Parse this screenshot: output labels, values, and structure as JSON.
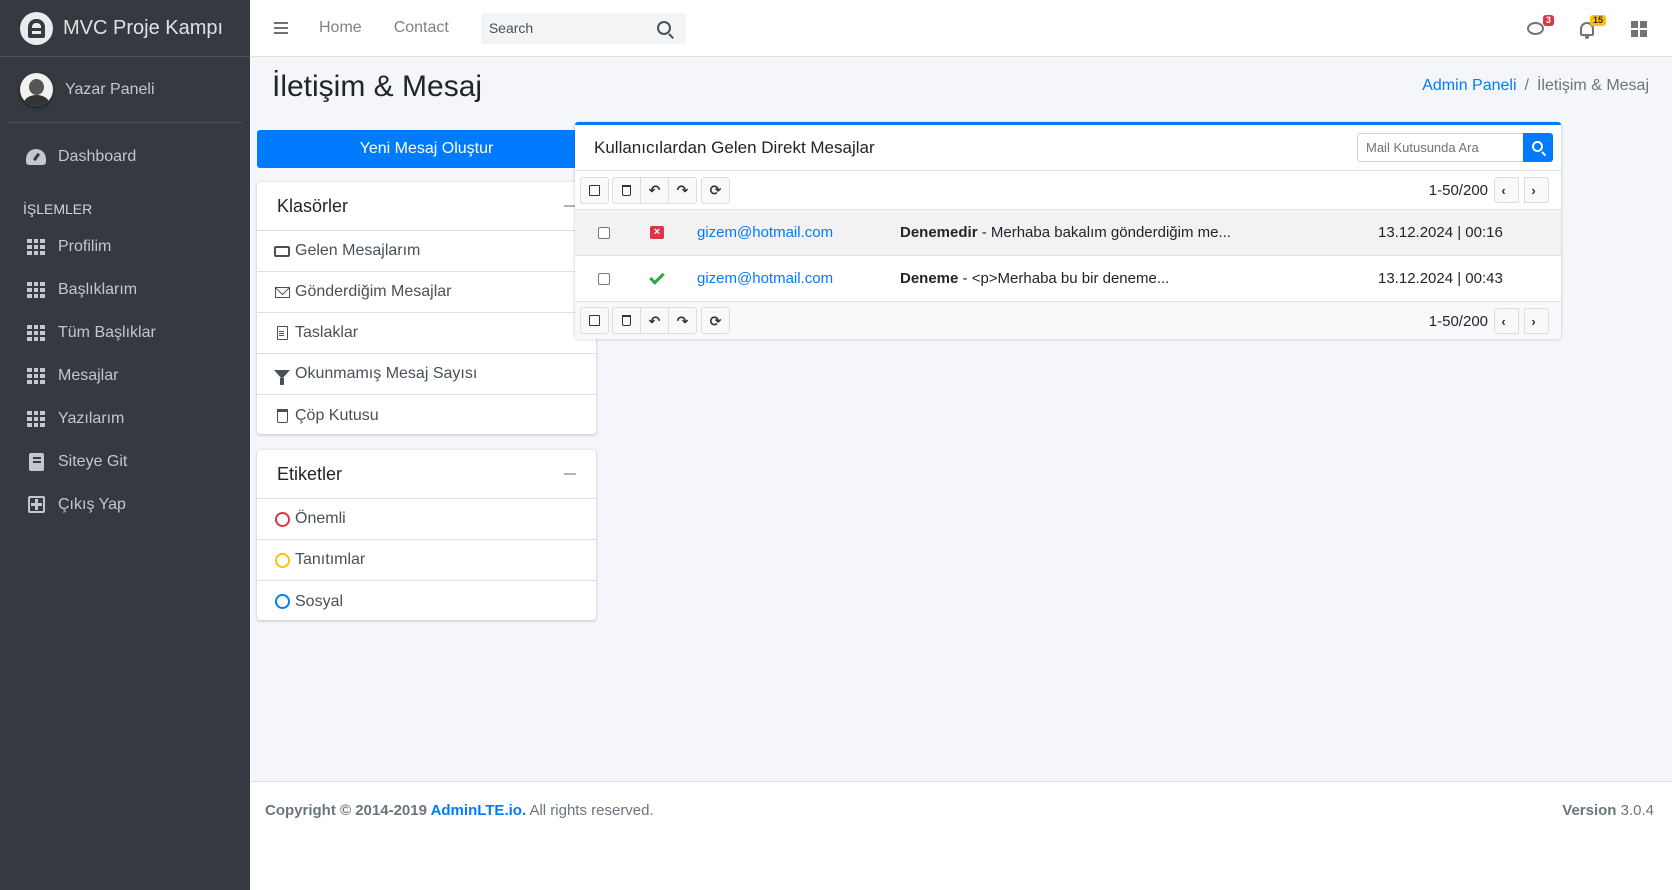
{
  "brand": {
    "name": "MVC Proje Kampı"
  },
  "user": {
    "name": "Yazar Paneli"
  },
  "sidebar": {
    "dashboard": "Dashboard",
    "section_header": "İŞLEMLER",
    "items": [
      {
        "label": "Profilim",
        "icon": "grid-icon"
      },
      {
        "label": "Başlıklarım",
        "icon": "grid-icon"
      },
      {
        "label": "Tüm Başlıklar",
        "icon": "grid-icon"
      },
      {
        "label": "Mesajlar",
        "icon": "grid-icon"
      },
      {
        "label": "Yazılarım",
        "icon": "grid-icon"
      },
      {
        "label": "Siteye Git",
        "icon": "book-icon"
      },
      {
        "label": "Çıkış Yap",
        "icon": "plus-square-icon"
      }
    ]
  },
  "topbar": {
    "links": [
      "Home",
      "Contact"
    ],
    "search_placeholder": "Search",
    "messages_badge": "3",
    "notifications_badge": "15"
  },
  "page": {
    "title": "İletişim & Mesaj",
    "breadcrumb": [
      "Admin Paneli",
      "İletişim & Mesaj"
    ]
  },
  "compose_button": "Yeni Mesaj Oluştur",
  "folders": {
    "title": "Klasörler",
    "items": [
      {
        "label": "Gelen Mesajlarım",
        "icon": "inbox-icon"
      },
      {
        "label": "Gönderdiğim Mesajlar",
        "icon": "envelope-icon"
      },
      {
        "label": "Taslaklar",
        "icon": "file-icon"
      },
      {
        "label": "Okunmamış Mesaj Sayısı",
        "icon": "filter-icon"
      },
      {
        "label": "Çöp Kutusu",
        "icon": "trash-icon"
      }
    ]
  },
  "labels": {
    "title": "Etiketler",
    "items": [
      {
        "label": "Önemli",
        "color": "#dc3545"
      },
      {
        "label": "Tanıtımlar",
        "color": "#ffc107"
      },
      {
        "label": "Sosyal",
        "color": "#007bff"
      }
    ]
  },
  "mailbox": {
    "title": "Kullanıcılardan Gelen Direkt Mesajlar",
    "search_placeholder": "Mail Kutusunda Ara",
    "pagination": "1-50/200",
    "messages": [
      {
        "status": "unread",
        "sender": "gizem@hotmail.com",
        "subject": "Denemedir",
        "preview": " - Merhaba bakalım gönderdiğim me...",
        "date": "13.12.2024 | 00:16"
      },
      {
        "status": "read",
        "sender": "gizem@hotmail.com",
        "subject": "Deneme",
        "preview": " - <p>Merhaba bu bir deneme...",
        "date": "13.12.2024 | 00:43"
      }
    ]
  },
  "footer": {
    "copyright": "Copyright © 2014-2019 ",
    "brand_link": "AdminLTE.io.",
    "rights": " All rights reserved.",
    "version_label": "Version",
    "version": " 3.0.4"
  }
}
